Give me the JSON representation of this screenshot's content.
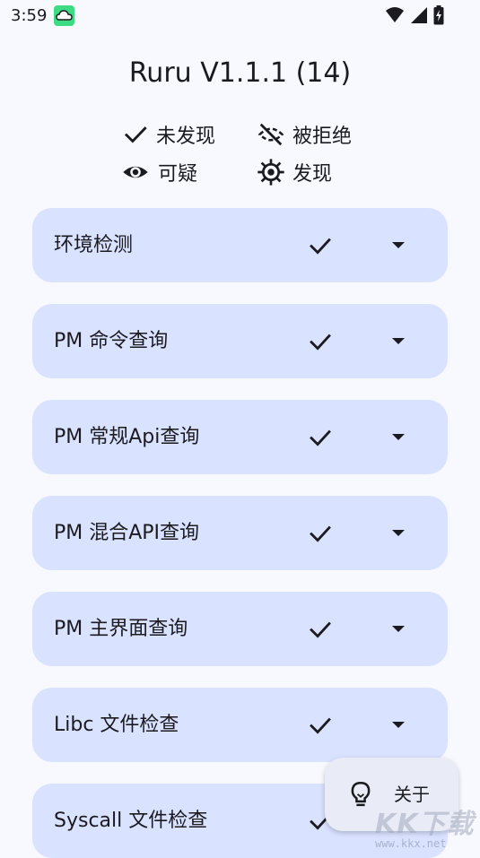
{
  "status_bar": {
    "time": "3:59",
    "app_icon": "cloud-app-icon",
    "icons": [
      "wifi-icon",
      "signal-icon",
      "battery-charging-icon"
    ]
  },
  "title": "Ruru V1.1.1 (14)",
  "legend": {
    "not_found": {
      "icon": "check-icon",
      "label": "未发现"
    },
    "denied": {
      "icon": "eye-off-icon",
      "label": "被拒绝"
    },
    "suspicious": {
      "icon": "eye-icon",
      "label": "可疑"
    },
    "found": {
      "icon": "bug-icon",
      "label": "发现"
    }
  },
  "checks": [
    {
      "label": "环境检测",
      "status_icon": "check-icon",
      "expand_icon": "caret-down-icon"
    },
    {
      "label": "PM 命令查询",
      "status_icon": "check-icon",
      "expand_icon": "caret-down-icon"
    },
    {
      "label": "PM 常规Api查询",
      "status_icon": "check-icon",
      "expand_icon": "caret-down-icon"
    },
    {
      "label": "PM 混合API查询",
      "status_icon": "check-icon",
      "expand_icon": "caret-down-icon"
    },
    {
      "label": "PM 主界面查询",
      "status_icon": "check-icon",
      "expand_icon": "caret-down-icon"
    },
    {
      "label": "Libc 文件检查",
      "status_icon": "check-icon",
      "expand_icon": "caret-down-icon"
    },
    {
      "label": "Syscall 文件检查",
      "status_icon": "check-icon",
      "expand_icon": "caret-down-icon"
    }
  ],
  "fab": {
    "icon": "lightbulb-icon",
    "label": "关于"
  },
  "watermark": {
    "text": "KK下载",
    "url": "www.kkx.net"
  },
  "colors": {
    "background": "#f8f9ff",
    "card": "#d9e2ff",
    "fab": "#e9ecf7",
    "text": "#1b1b1f"
  }
}
